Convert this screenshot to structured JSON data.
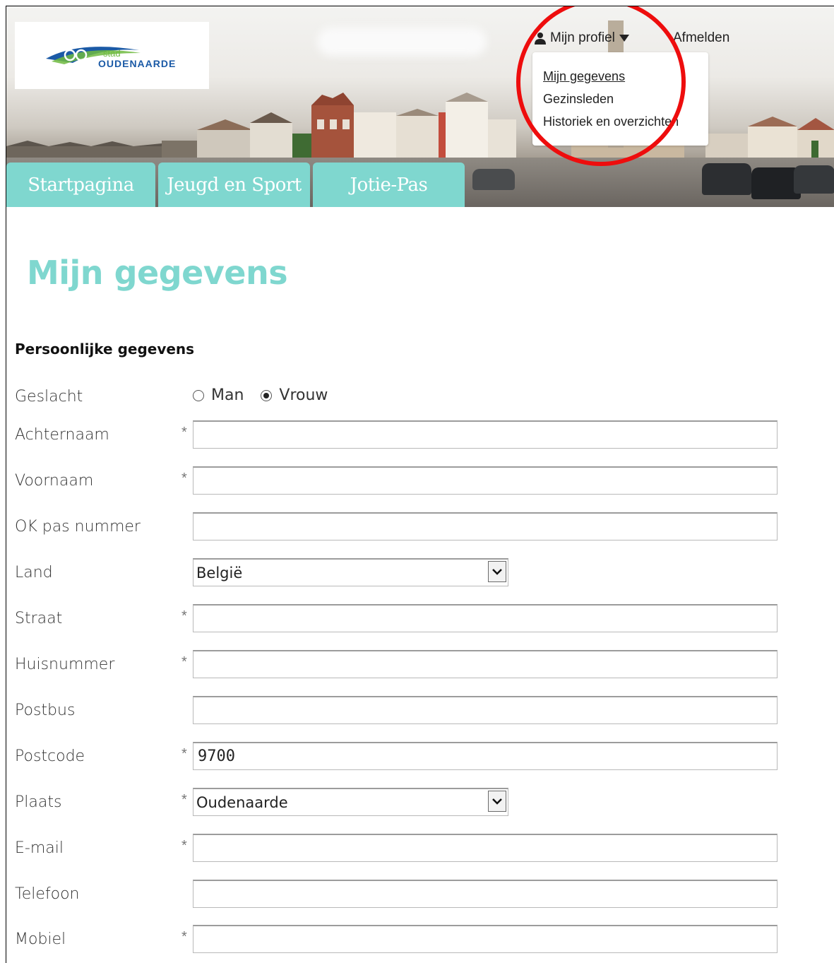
{
  "header": {
    "logo": {
      "top_text": "stad",
      "name": "OUDENAARDE"
    },
    "profile_menu": {
      "trigger_label": "Mijn profiel",
      "logout_label": "Afmelden",
      "items": [
        {
          "label": "Mijn gegevens"
        },
        {
          "label": "Gezinsleden"
        },
        {
          "label": "Historiek en overzichten"
        }
      ]
    },
    "tabs": [
      {
        "label": "Startpagina"
      },
      {
        "label": "Jeugd en Sport"
      },
      {
        "label": "Jotie-Pas"
      }
    ]
  },
  "page": {
    "title": "Mijn gegevens",
    "section_title": "Persoonlijke gegevens",
    "required_marker": "*"
  },
  "form": {
    "gender": {
      "label": "Geslacht",
      "options": [
        "Man",
        "Vrouw"
      ],
      "selected": "Vrouw"
    },
    "fields": {
      "achternaam": {
        "label": "Achternaam",
        "value": ""
      },
      "voornaam": {
        "label": "Voornaam",
        "value": ""
      },
      "ok_pas": {
        "label": "OK pas nummer",
        "value": ""
      },
      "land": {
        "label": "Land",
        "value": "België"
      },
      "straat": {
        "label": "Straat",
        "value": ""
      },
      "huisnummer": {
        "label": "Huisnummer",
        "value": ""
      },
      "postbus": {
        "label": "Postbus",
        "value": ""
      },
      "postcode": {
        "label": "Postcode",
        "value": "9700"
      },
      "plaats": {
        "label": "Plaats",
        "value": "Oudenaarde"
      },
      "email": {
        "label": "E-mail",
        "value": ""
      },
      "telefoon": {
        "label": "Telefoon",
        "value": ""
      },
      "mobiel": {
        "label": "Mobiel",
        "value": ""
      }
    }
  },
  "colors": {
    "accent": "#7fd7cf",
    "highlight_circle": "#ee0d0d",
    "logo_blue": "#1b5aa6",
    "logo_green": "#6fba3f"
  }
}
